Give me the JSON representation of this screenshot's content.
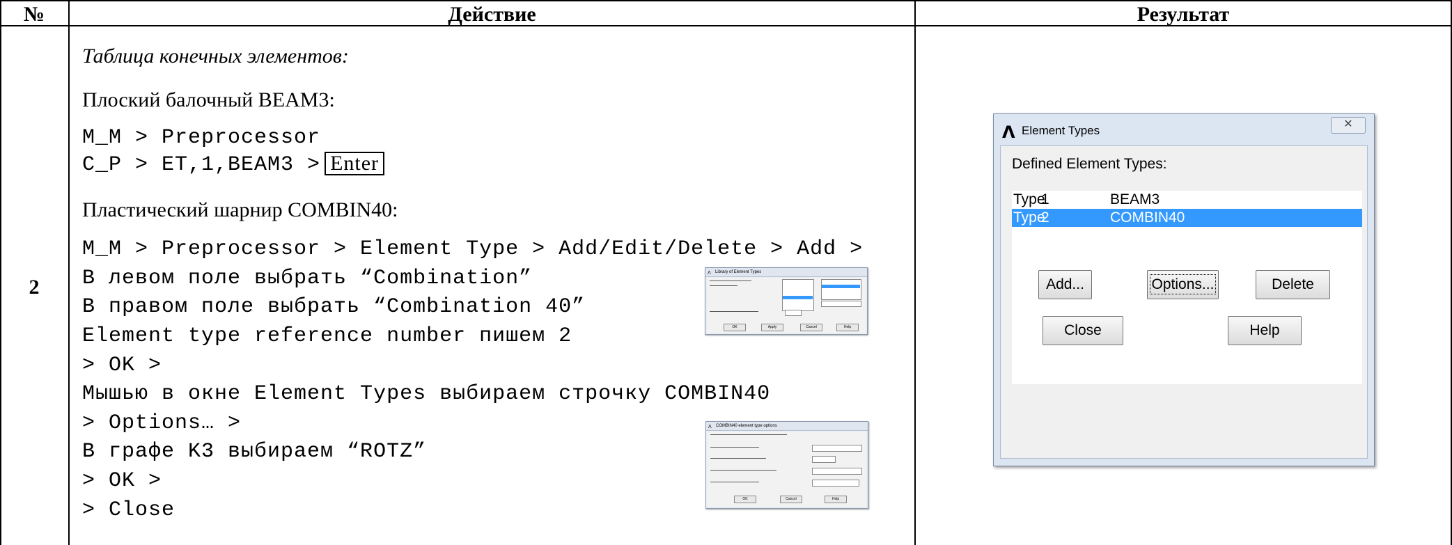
{
  "table": {
    "headers": {
      "num": "№",
      "action": "Действие",
      "result": "Результат"
    },
    "row_number": "2"
  },
  "action": {
    "heading": "Таблица конечных элементов:",
    "beam_title": "Плоский балочный BEAM3:",
    "beam_line1": "M_M > Preprocessor",
    "beam_line2": "C_P > ET,1,BEAM3 >",
    "enter_key": "Enter",
    "combin_title": "Пластический шарнир COMBIN40:",
    "steps": [
      "M_M > Preprocessor > Element Type > Add/Edit/Delete > Add >",
      "В левом поле выбрать “Combination”",
      "В правом поле выбрать “Combination 40”",
      "Element type reference number пишем 2",
      "> OK >",
      "Мышью в окне Element Types выбираем строчку COMBIN40",
      "> Options… >",
      "В графе K3 выбираем “ROTZ”",
      "> OK >",
      "> Close"
    ]
  },
  "dialog": {
    "title": "Element Types",
    "label": "Defined Element Types:",
    "rows": [
      {
        "c1": "Type",
        "c2": "1",
        "c3": "BEAM3",
        "selected": false
      },
      {
        "c1": "Type",
        "c2": "2",
        "c3": "COMBIN40",
        "selected": true
      }
    ],
    "buttons": {
      "add": "Add...",
      "options": "Options...",
      "delete": "Delete",
      "close": "Close",
      "help": "Help"
    },
    "selection_color": "#3399ff"
  },
  "thumb_library": {
    "title": "Library of Element Types",
    "ok": "OK",
    "apply": "Apply",
    "cancel": "Cancel",
    "help": "Help"
  },
  "thumb_options": {
    "title": "COMBIN40 element type options",
    "ok": "OK",
    "cancel": "Cancel",
    "help": "Help"
  }
}
